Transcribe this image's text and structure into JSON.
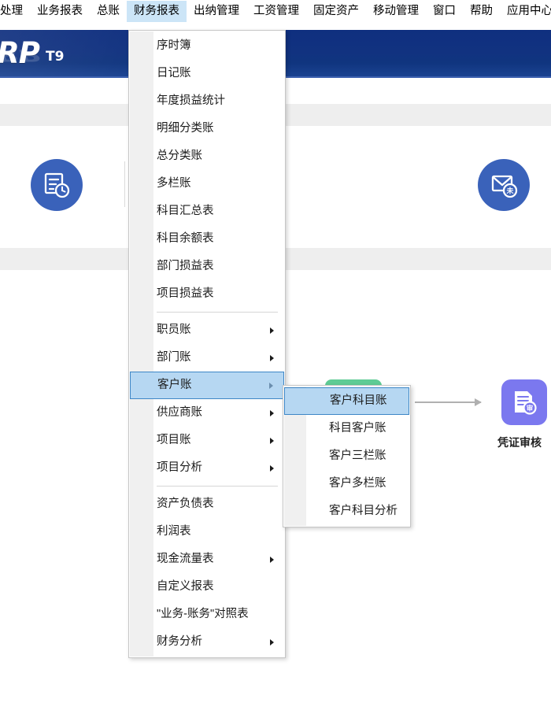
{
  "app": {
    "logo_main": "ERP",
    "logo_sub": "T9"
  },
  "menubar": {
    "items": [
      {
        "label": "处理",
        "name": "menu-chuli",
        "active": false
      },
      {
        "label": "业务报表",
        "name": "menu-yewubaobiao",
        "active": false
      },
      {
        "label": "总账",
        "name": "menu-zongzhang",
        "active": false
      },
      {
        "label": "财务报表",
        "name": "menu-caiwubaobiao",
        "active": true
      },
      {
        "label": "出纳管理",
        "name": "menu-chunaguanli",
        "active": false
      },
      {
        "label": "工资管理",
        "name": "menu-gongziguanli",
        "active": false
      },
      {
        "label": "固定资产",
        "name": "menu-gudingzichan",
        "active": false
      },
      {
        "label": "移动管理",
        "name": "menu-yidongguanli",
        "active": false
      },
      {
        "label": "窗口",
        "name": "menu-chuangkou",
        "active": false
      },
      {
        "label": "帮助",
        "name": "menu-bangzhu",
        "active": false
      },
      {
        "label": "应用中心",
        "name": "menu-yingyongzhongxin",
        "active": false
      }
    ]
  },
  "dropdown": {
    "items": [
      {
        "label": "序时簿",
        "submenu": false,
        "selected": false,
        "separator_after": false
      },
      {
        "label": "日记账",
        "submenu": false,
        "selected": false,
        "separator_after": false
      },
      {
        "label": "年度损益统计",
        "submenu": false,
        "selected": false,
        "separator_after": false
      },
      {
        "label": "明细分类账",
        "submenu": false,
        "selected": false,
        "separator_after": false
      },
      {
        "label": "总分类账",
        "submenu": false,
        "selected": false,
        "separator_after": false
      },
      {
        "label": "多栏账",
        "submenu": false,
        "selected": false,
        "separator_after": false
      },
      {
        "label": "科目汇总表",
        "submenu": false,
        "selected": false,
        "separator_after": false
      },
      {
        "label": "科目余额表",
        "submenu": false,
        "selected": false,
        "separator_after": false
      },
      {
        "label": "部门损益表",
        "submenu": false,
        "selected": false,
        "separator_after": false
      },
      {
        "label": "项目损益表",
        "submenu": false,
        "selected": false,
        "separator_after": true
      },
      {
        "label": "职员账",
        "submenu": true,
        "selected": false,
        "separator_after": false
      },
      {
        "label": "部门账",
        "submenu": true,
        "selected": false,
        "separator_after": false
      },
      {
        "label": "客户账",
        "submenu": true,
        "selected": true,
        "separator_after": false
      },
      {
        "label": "供应商账",
        "submenu": true,
        "selected": false,
        "separator_after": false
      },
      {
        "label": "项目账",
        "submenu": true,
        "selected": false,
        "separator_after": false
      },
      {
        "label": "项目分析",
        "submenu": true,
        "selected": false,
        "separator_after": true
      },
      {
        "label": "资产负债表",
        "submenu": false,
        "selected": false,
        "separator_after": false
      },
      {
        "label": "利润表",
        "submenu": false,
        "selected": false,
        "separator_after": false
      },
      {
        "label": "现金流量表",
        "submenu": true,
        "selected": false,
        "separator_after": false
      },
      {
        "label": "自定义报表",
        "submenu": false,
        "selected": false,
        "separator_after": false
      },
      {
        "label": "\"业务-账务\"对照表",
        "submenu": false,
        "selected": false,
        "separator_after": false
      },
      {
        "label": "财务分析",
        "submenu": true,
        "selected": false,
        "separator_after": false
      }
    ]
  },
  "submenu": {
    "parent": "客户账",
    "items": [
      {
        "label": "客户科目账",
        "selected": true
      },
      {
        "label": "科目客户账",
        "selected": false
      },
      {
        "label": "客户三栏账",
        "selected": false
      },
      {
        "label": "客户多栏账",
        "selected": false
      },
      {
        "label": "客户科目分析",
        "selected": false
      }
    ]
  },
  "workspace": {
    "cards": [
      {
        "icon": "document-clock-icon",
        "name": "card-left"
      },
      {
        "icon": "envelope-unread-icon",
        "name": "card-right"
      }
    ],
    "flow_node": {
      "label": "凭证审核",
      "icon": "voucher-audit-icon"
    }
  },
  "colors": {
    "banner_blue": "#113280",
    "menu_highlight": "#cce5f7",
    "selection_fill": "#b6d7f2",
    "selection_border": "#3d86c6",
    "icon_blue": "#3a62ba",
    "node_purple": "#7b78ef",
    "tab_green": "#5fcc95"
  }
}
